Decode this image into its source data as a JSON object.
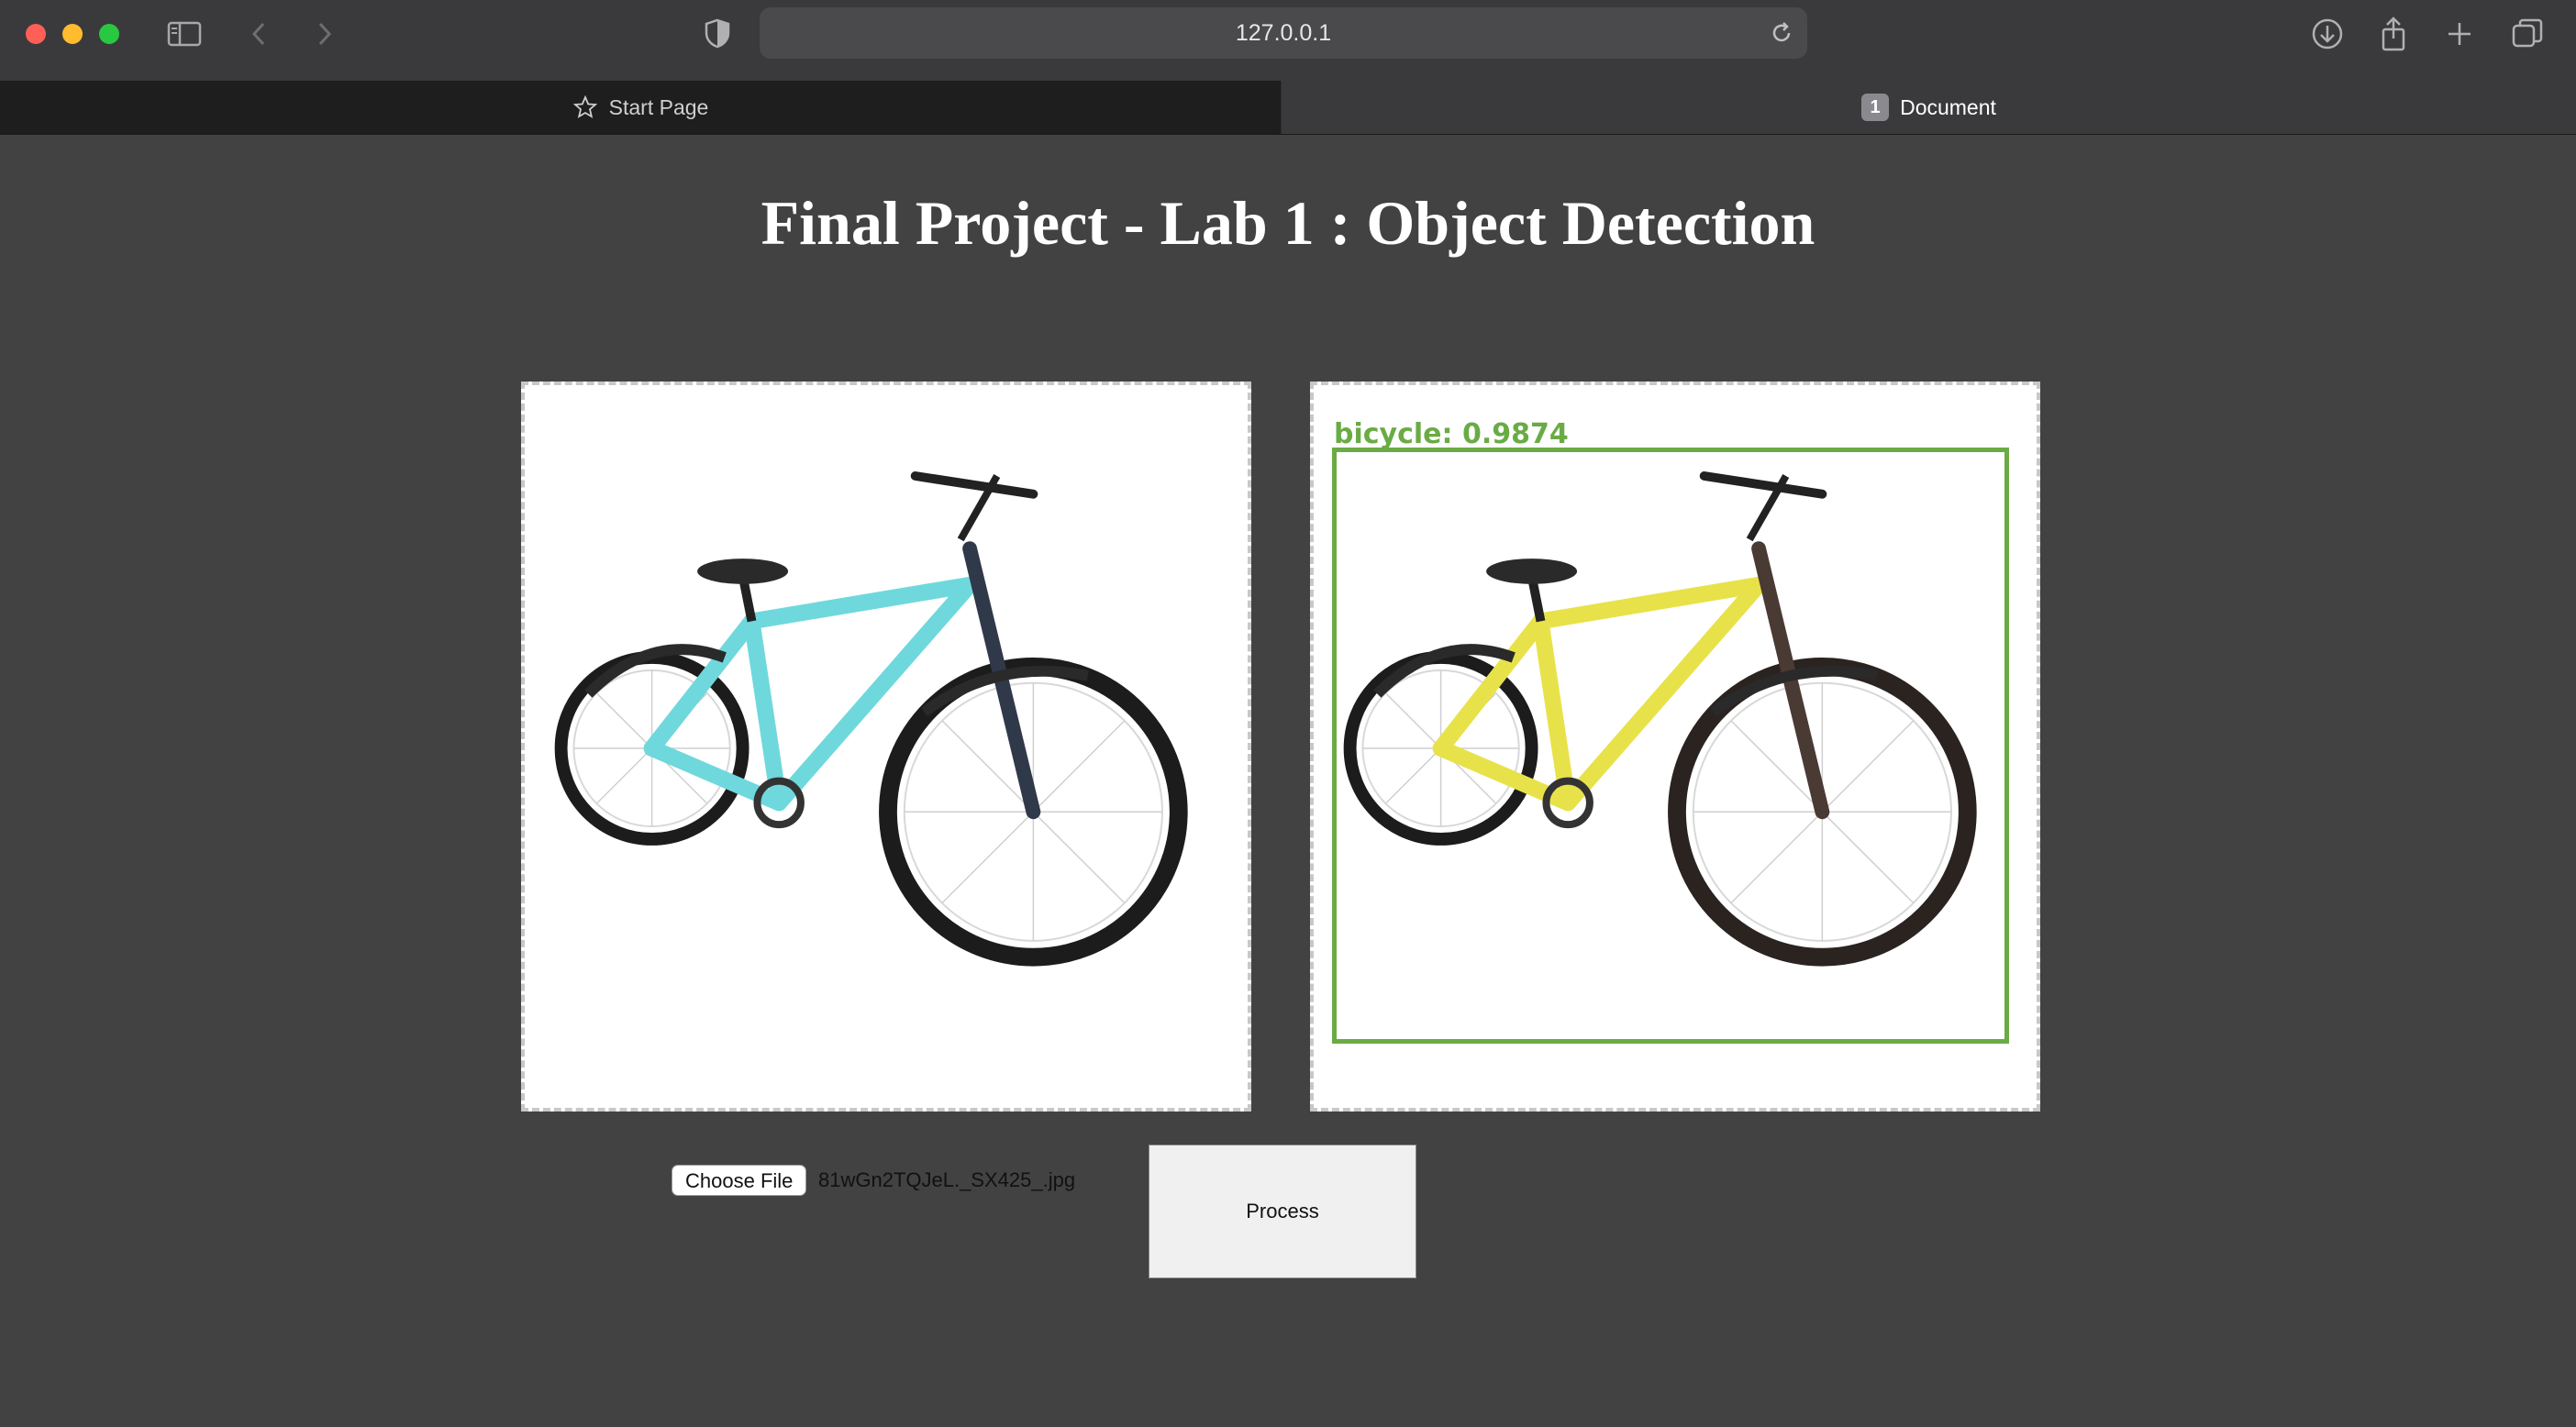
{
  "browser": {
    "url": "127.0.0.1",
    "tabs": [
      {
        "label": "Start Page",
        "icon": "star-icon"
      },
      {
        "label": "Document",
        "badge": "1"
      }
    ]
  },
  "page": {
    "title": "Final Project - Lab 1 : Object Detection",
    "input_image": {
      "subject": "bicycle",
      "frame_color": "#6fd8dc"
    },
    "output_image": {
      "subject": "bicycle",
      "frame_color": "#e8e24a",
      "detection_label": "bicycle: 0.9874",
      "box_color": "#6aab45"
    },
    "file_input": {
      "button_label": "Choose File",
      "file_name": "81wGn2TQJeL._SX425_.jpg"
    },
    "process_button": {
      "label": "Process"
    }
  }
}
